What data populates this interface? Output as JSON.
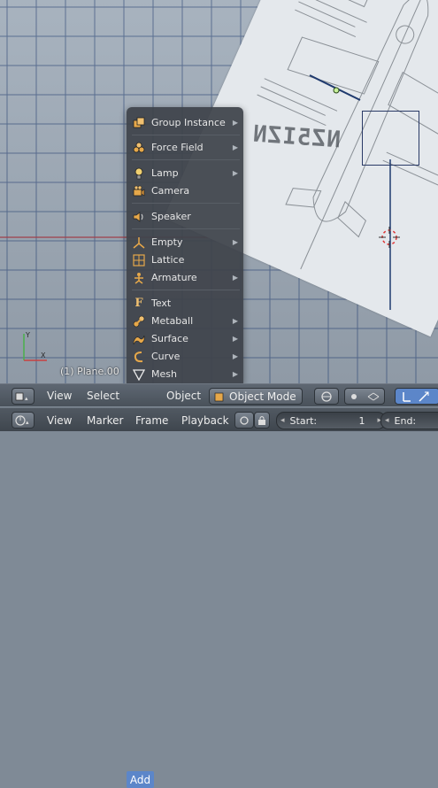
{
  "add_menu": {
    "items": [
      {
        "label": "Group Instance",
        "icon": "group-instance-icon",
        "submenu": true
      },
      {
        "label": "Force Field",
        "icon": "force-field-icon",
        "submenu": true
      },
      {
        "label": "Lamp",
        "icon": "lamp-icon",
        "submenu": true
      },
      {
        "label": "Camera",
        "icon": "camera-icon",
        "submenu": false
      },
      {
        "label": "Speaker",
        "icon": "speaker-icon",
        "submenu": false
      },
      {
        "label": "Empty",
        "icon": "empty-icon",
        "submenu": true
      },
      {
        "label": "Lattice",
        "icon": "lattice-icon",
        "submenu": false
      },
      {
        "label": "Armature",
        "icon": "armature-icon",
        "submenu": true
      },
      {
        "label": "Text",
        "icon": "text-icon",
        "submenu": false
      },
      {
        "label": "Metaball",
        "icon": "metaball-icon",
        "submenu": true
      },
      {
        "label": "Surface",
        "icon": "surface-icon",
        "submenu": true
      },
      {
        "label": "Curve",
        "icon": "curve-icon",
        "submenu": true
      },
      {
        "label": "Mesh",
        "icon": "mesh-icon",
        "submenu": true
      }
    ],
    "submenu_arrow": "▶"
  },
  "viewport": {
    "object_label": "(1) Plane.00",
    "registration_text": "NZ5IZN"
  },
  "header_3d": {
    "view": "View",
    "select": "Select",
    "add": "Add",
    "object": "Object",
    "mode": "Object Mode"
  },
  "timeline": {
    "view": "View",
    "marker": "Marker",
    "frame": "Frame",
    "playback": "Playback",
    "start_label": "Start:",
    "start_value": "1",
    "end_label": "End:"
  },
  "colors": {
    "menu_bg": "#3e434a",
    "header_bg": "#5e6772",
    "add_active": "#5c86c9",
    "grid_line": "#2d4a7a"
  }
}
